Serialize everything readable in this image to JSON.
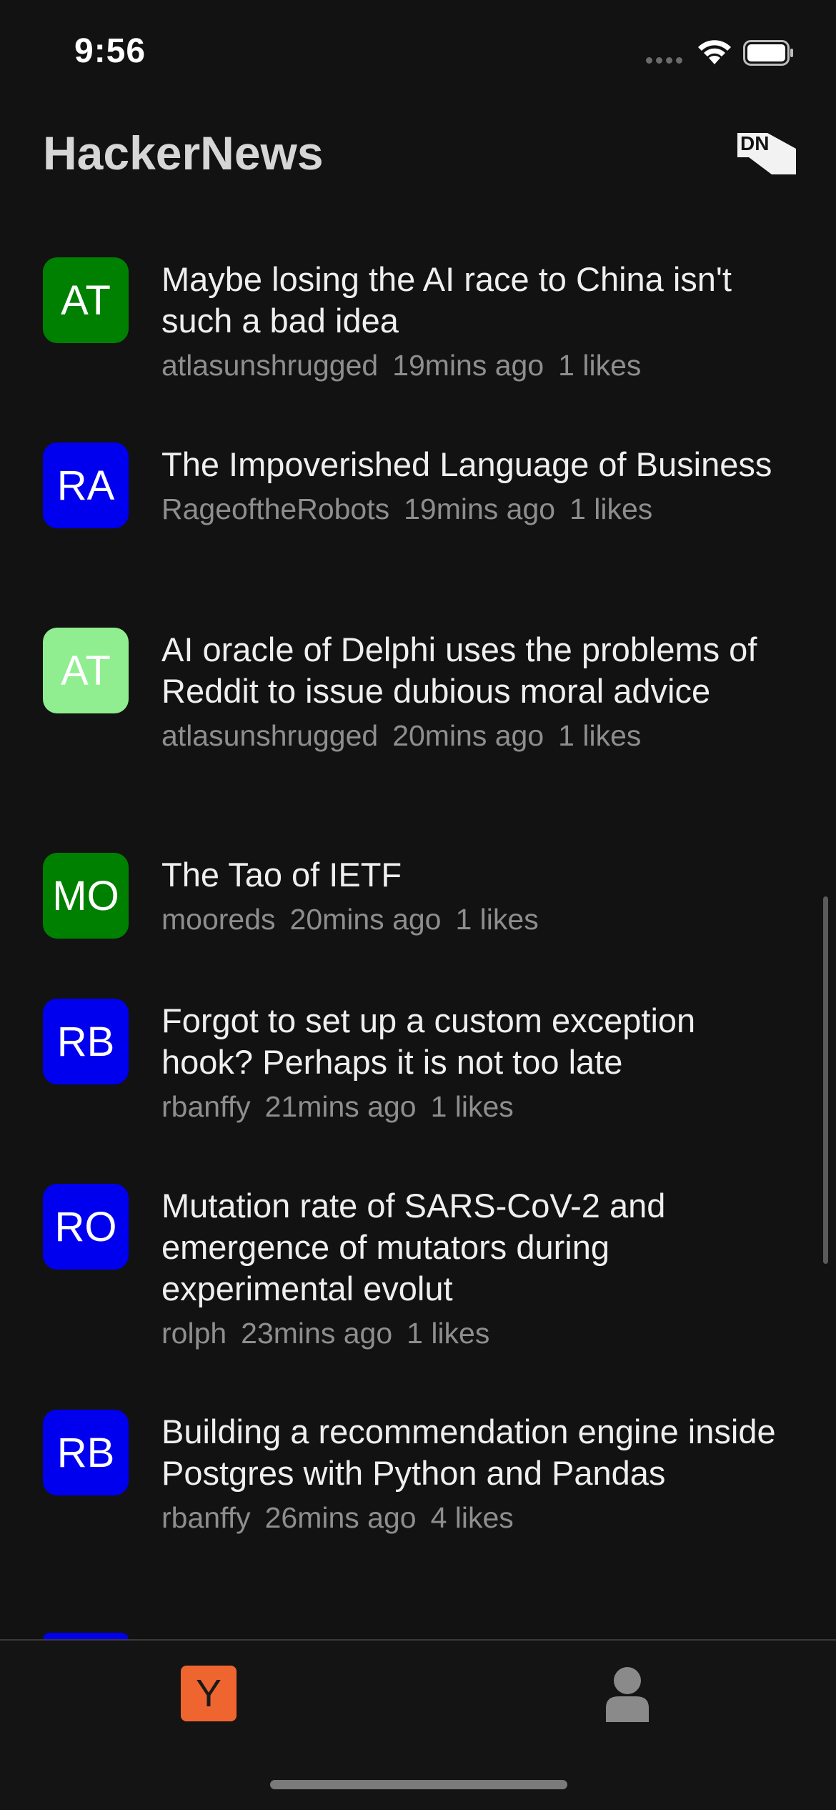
{
  "status_bar": {
    "time": "9:56"
  },
  "header": {
    "title": "HackerNews",
    "logo_text": "DN"
  },
  "stories": [
    {
      "initials": "AT",
      "avatar_color": "#008000",
      "title": "Maybe losing the AI race to China isn't such a bad idea",
      "author": "atlasunshrugged",
      "time": "19mins ago",
      "likes": "1 likes"
    },
    {
      "initials": "RA",
      "avatar_color": "#0000ee",
      "title": "The Impoverished Language of Business",
      "author": "RageoftheRobots",
      "time": "19mins ago",
      "likes": "1 likes"
    },
    {
      "initials": "AT",
      "avatar_color": "#90ee90",
      "title": "AI oracle of Delphi uses the problems of Reddit to issue dubious moral advice",
      "author": "atlasunshrugged",
      "time": "20mins ago",
      "likes": "1 likes"
    },
    {
      "initials": "MO",
      "avatar_color": "#008000",
      "title": "The Tao of IETF",
      "author": "mooreds",
      "time": "20mins ago",
      "likes": "1 likes"
    },
    {
      "initials": "RB",
      "avatar_color": "#0000ee",
      "title": "Forgot to set up a custom exception hook? Perhaps it is not too late",
      "author": "rbanffy",
      "time": "21mins ago",
      "likes": "1 likes"
    },
    {
      "initials": "RO",
      "avatar_color": "#0000ee",
      "title": "Mutation rate of SARS-CoV-2 and emergence of mutators during experimental evolut",
      "author": "rolph",
      "time": "23mins ago",
      "likes": "1 likes"
    },
    {
      "initials": "RB",
      "avatar_color": "#0000ee",
      "title": "Building a recommendation engine inside Postgres with Python and Pandas",
      "author": "rbanffy",
      "time": "26mins ago",
      "likes": "4 likes"
    }
  ],
  "tab_bar": {
    "hn_tab_label": "Y",
    "hn_tab_color": "#ef6530"
  }
}
